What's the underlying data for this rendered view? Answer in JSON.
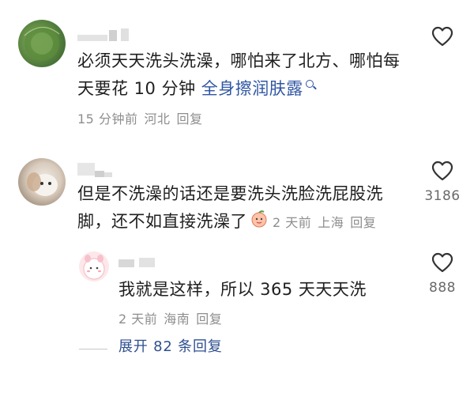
{
  "comments": [
    {
      "text_line1": "必须天天洗头洗澡，哪怕来了北方、哪怕每",
      "text_line2_prefix": "天要花 10 分钟 ",
      "link": "全身擦润肤露",
      "time": "15 分钟前",
      "location": "河北",
      "reply": "回复",
      "likes": ""
    },
    {
      "text_line1": "但是不洗澡的话还是要洗头洗脸洗屁股洗",
      "text_line2": "脚，还不如直接洗澡了",
      "time": "2 天前",
      "location": "上海",
      "reply": "回复",
      "likes": "3186"
    },
    {
      "text_line1": "我就是这样，所以 365 天天天洗",
      "time": "2 天前",
      "location": "海南",
      "reply": "回复",
      "likes": "888"
    }
  ],
  "expand_replies": "展开 82 条回复",
  "icons": {
    "like": "heart-outline-icon",
    "search": "search-icon",
    "emoji": "peach-face-emoji"
  },
  "colors": {
    "link": "#2f56a3",
    "meta": "#8e8e8e",
    "text": "#1f1f1f"
  }
}
